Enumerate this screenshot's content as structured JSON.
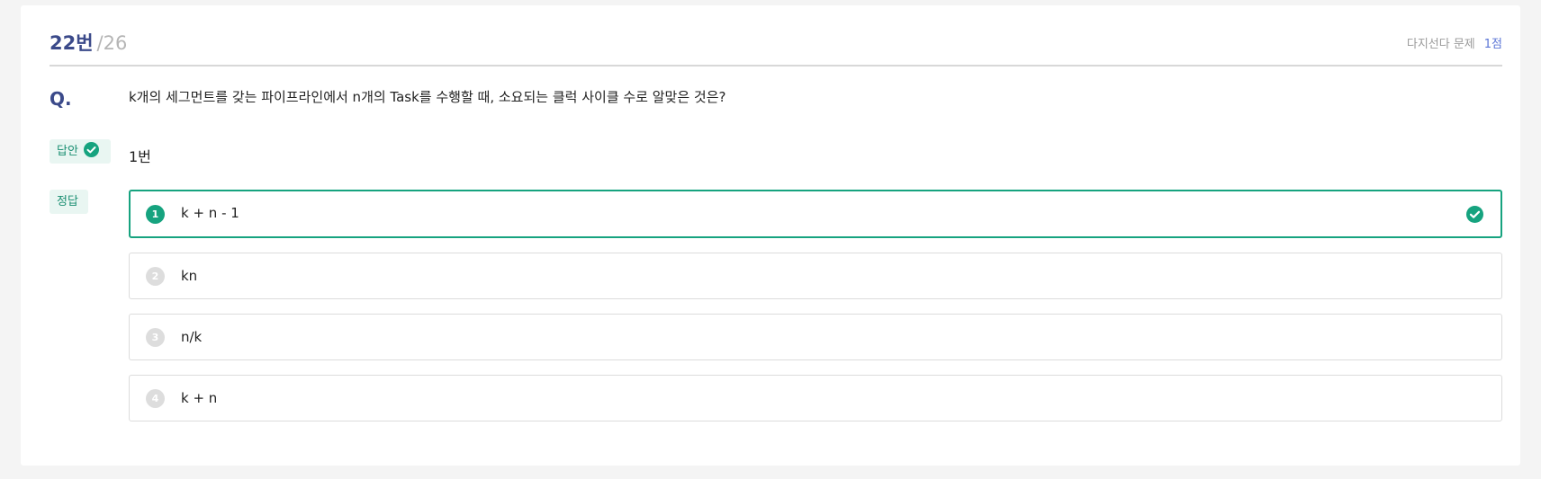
{
  "header": {
    "number": "22번",
    "total": "/26",
    "type": "다지선다 문제",
    "points": "1점"
  },
  "question": {
    "label": "Q.",
    "text": "k개의 세그먼트를 갖는 파이프라인에서 n개의 Task를 수행할 때, 소요되는 클럭 사이클 수로 알맞은 것은?"
  },
  "answer": {
    "tag": "답안",
    "value": "1번",
    "status_icon": "check-circle-icon"
  },
  "correct": {
    "tag": "정답"
  },
  "options": [
    {
      "num": "1",
      "text": "k + n - 1",
      "correct": true
    },
    {
      "num": "2",
      "text": "kn",
      "correct": false
    },
    {
      "num": "3",
      "text": "n/k",
      "correct": false
    },
    {
      "num": "4",
      "text": "k + n",
      "correct": false
    }
  ],
  "colors": {
    "accent": "#16a37f",
    "title": "#3b4a8a",
    "points": "#5b75d6"
  }
}
